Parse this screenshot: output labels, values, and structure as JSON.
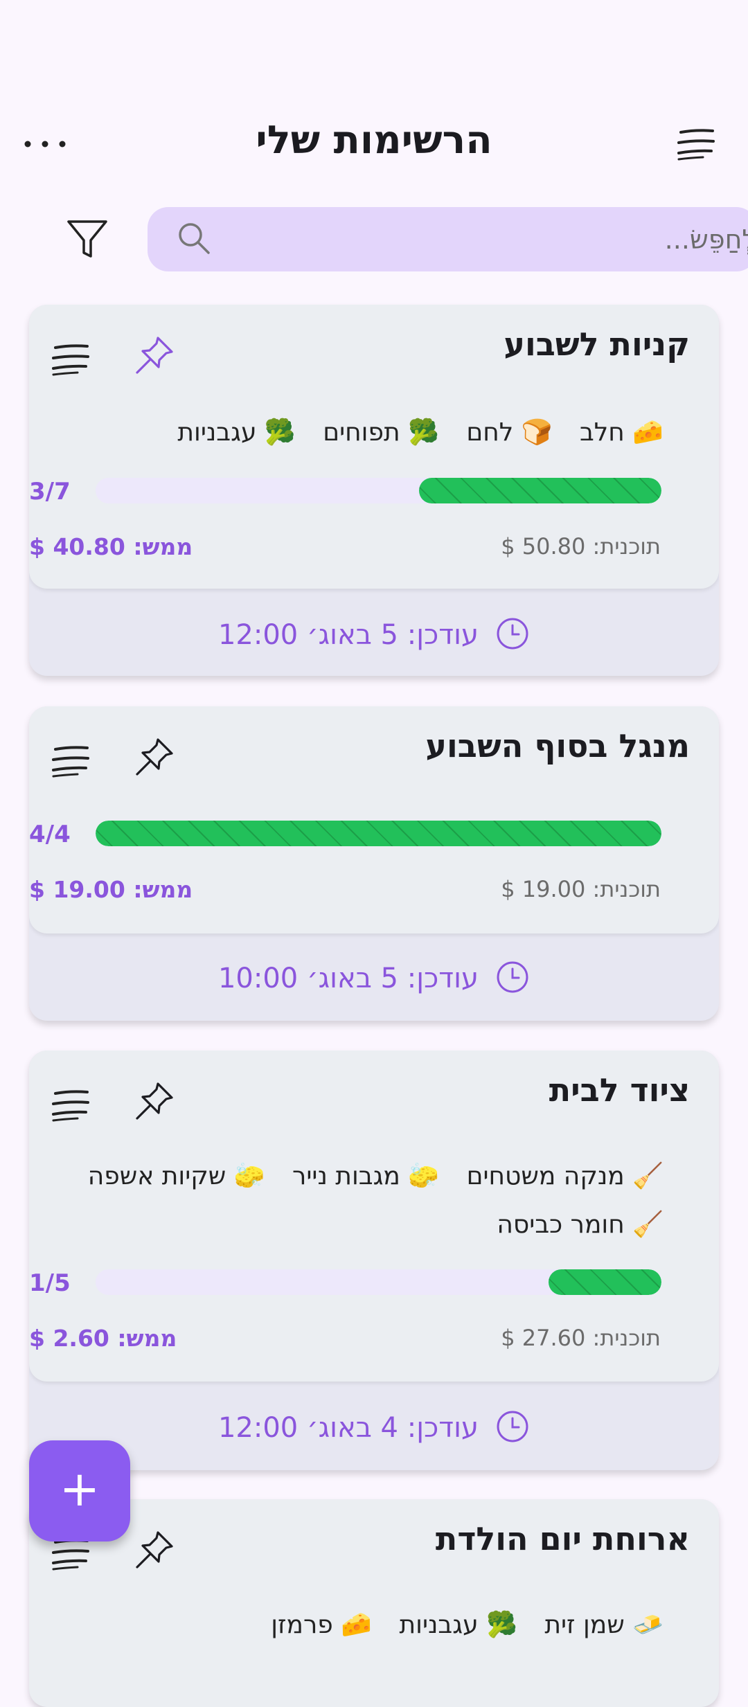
{
  "header": {
    "title": "הרשימות שלי"
  },
  "search": {
    "placeholder": "לְחַפֵּשׂ..."
  },
  "lists": [
    {
      "title": "קניות לשבוע",
      "pinned": true,
      "items": [
        "🧀 חלב",
        "🍞 לחם",
        "🥦 תפוחים",
        "🥦 עגבניות"
      ],
      "count": "3/7",
      "progress": 0.4286,
      "planned": "תוכנית: 50.80 $",
      "actual": "ממש: 40.80 $",
      "updated": "עודכן: 5 באוג׳ 12:00"
    },
    {
      "title": "מנגל בסוף השבוע",
      "pinned": false,
      "items": [],
      "count": "4/4",
      "progress": 1.0,
      "planned": "תוכנית: 19.00 $",
      "actual": "ממש: 19.00 $",
      "updated": "עודכן: 5 באוג׳ 10:00"
    },
    {
      "title": "ציוד לבית",
      "pinned": false,
      "items": [
        "🧹 מנקה משטחים",
        "🧽 מגבות נייר",
        "🧽 שקיות אשפה"
      ],
      "items_line2": [
        "🧹 חומר כביסה"
      ],
      "count": "1/5",
      "progress": 0.2,
      "planned": "תוכנית: 27.60 $",
      "actual": "ממש: 2.60 $",
      "updated": "עודכן: 4 באוג׳ 12:00"
    },
    {
      "title": "ארוחת יום הולדת",
      "pinned": false,
      "items": [
        "🧈 שמן זית",
        "🥦 עגבניות",
        "🧀 פרמזן"
      ]
    }
  ],
  "fab": {
    "label": "+"
  },
  "colors": {
    "accent": "#8b5cf0",
    "progress": "#22c05a",
    "search_bg": "#e3d5fb",
    "card_bg": "#ebeef2"
  }
}
